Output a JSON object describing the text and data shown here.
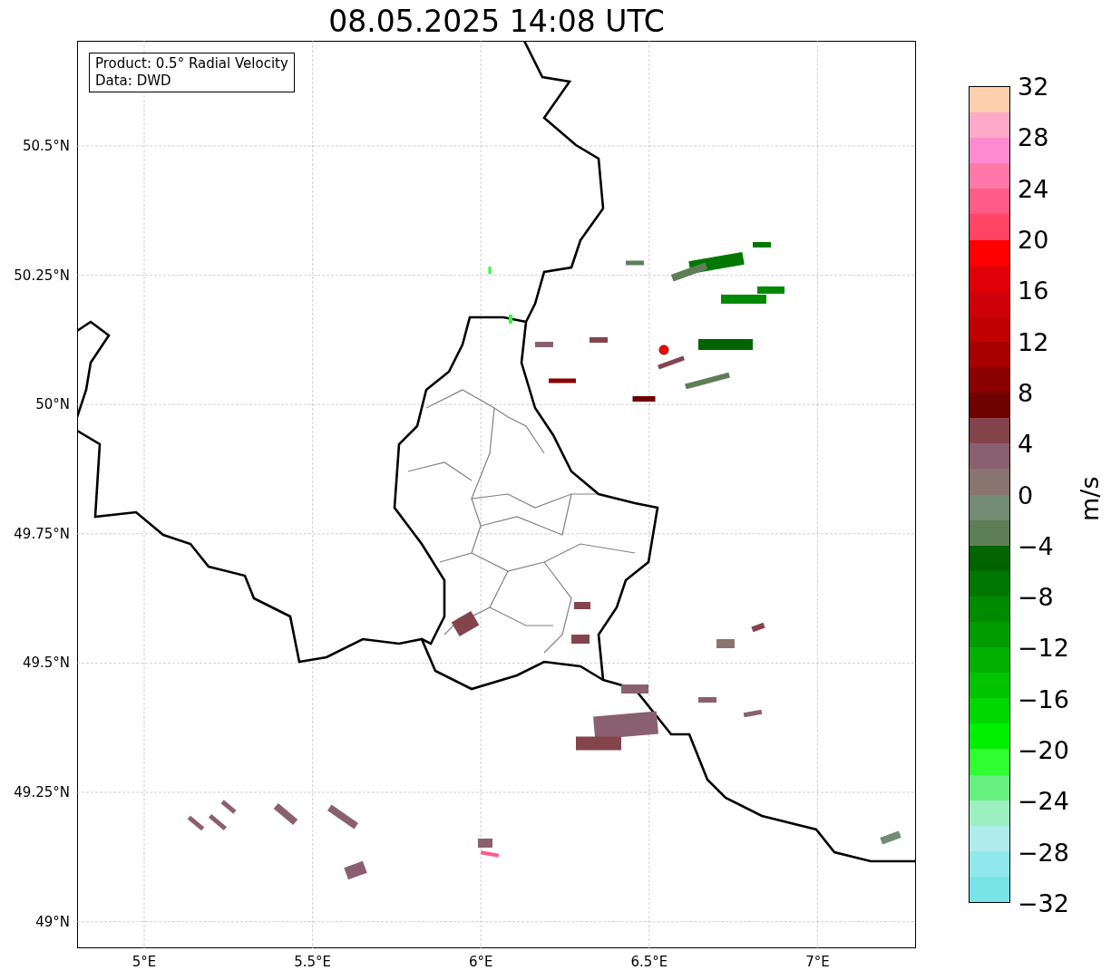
{
  "title": "08.05.2025 14:08 UTC",
  "legend": [
    "Product: 0.5° Radial Velocity",
    "Data: DWD"
  ],
  "lat_ticks": [
    {
      "label": "50.5°N"
    },
    {
      "label": "50.25°N"
    },
    {
      "label": "50°N"
    },
    {
      "label": "49.75°N"
    },
    {
      "label": "49.5°N"
    },
    {
      "label": "49.25°N"
    },
    {
      "label": "49°N"
    }
  ],
  "lon_ticks": [
    {
      "label": "5°E"
    },
    {
      "label": "5.5°E"
    },
    {
      "label": "6°E"
    },
    {
      "label": "6.5°E"
    },
    {
      "label": "7°E"
    }
  ],
  "colorbar": {
    "label": "m/s",
    "ticks": [
      "32",
      "28",
      "24",
      "20",
      "16",
      "12",
      "8",
      "4",
      "0",
      "−4",
      "−8",
      "−12",
      "−16",
      "−20",
      "−24",
      "−28",
      "−32"
    ],
    "bands": [
      {
        "color": "#ffcfae"
      },
      {
        "color": "#ffa9c8"
      },
      {
        "color": "#ff8ad0"
      },
      {
        "color": "#ff78a8"
      },
      {
        "color": "#ff5c88"
      },
      {
        "color": "#ff4466"
      },
      {
        "color": "#ff0000"
      },
      {
        "color": "#e00008"
      },
      {
        "color": "#d00008"
      },
      {
        "color": "#c00000"
      },
      {
        "color": "#a80000"
      },
      {
        "color": "#8b0000"
      },
      {
        "color": "#6e0000"
      },
      {
        "color": "#84444c"
      },
      {
        "color": "#8a6070"
      },
      {
        "color": "#8a7470"
      },
      {
        "color": "#738a74"
      },
      {
        "color": "#5e7e58"
      },
      {
        "color": "#006400"
      },
      {
        "color": "#007800"
      },
      {
        "color": "#008a00"
      },
      {
        "color": "#009c00"
      },
      {
        "color": "#00b000"
      },
      {
        "color": "#00c400"
      },
      {
        "color": "#00d800"
      },
      {
        "color": "#00f000"
      },
      {
        "color": "#30ff30"
      },
      {
        "color": "#66f080"
      },
      {
        "color": "#9cf0c0"
      },
      {
        "color": "#b0ecec"
      },
      {
        "color": "#90e8ec"
      },
      {
        "color": "#78e4e8"
      }
    ]
  }
}
